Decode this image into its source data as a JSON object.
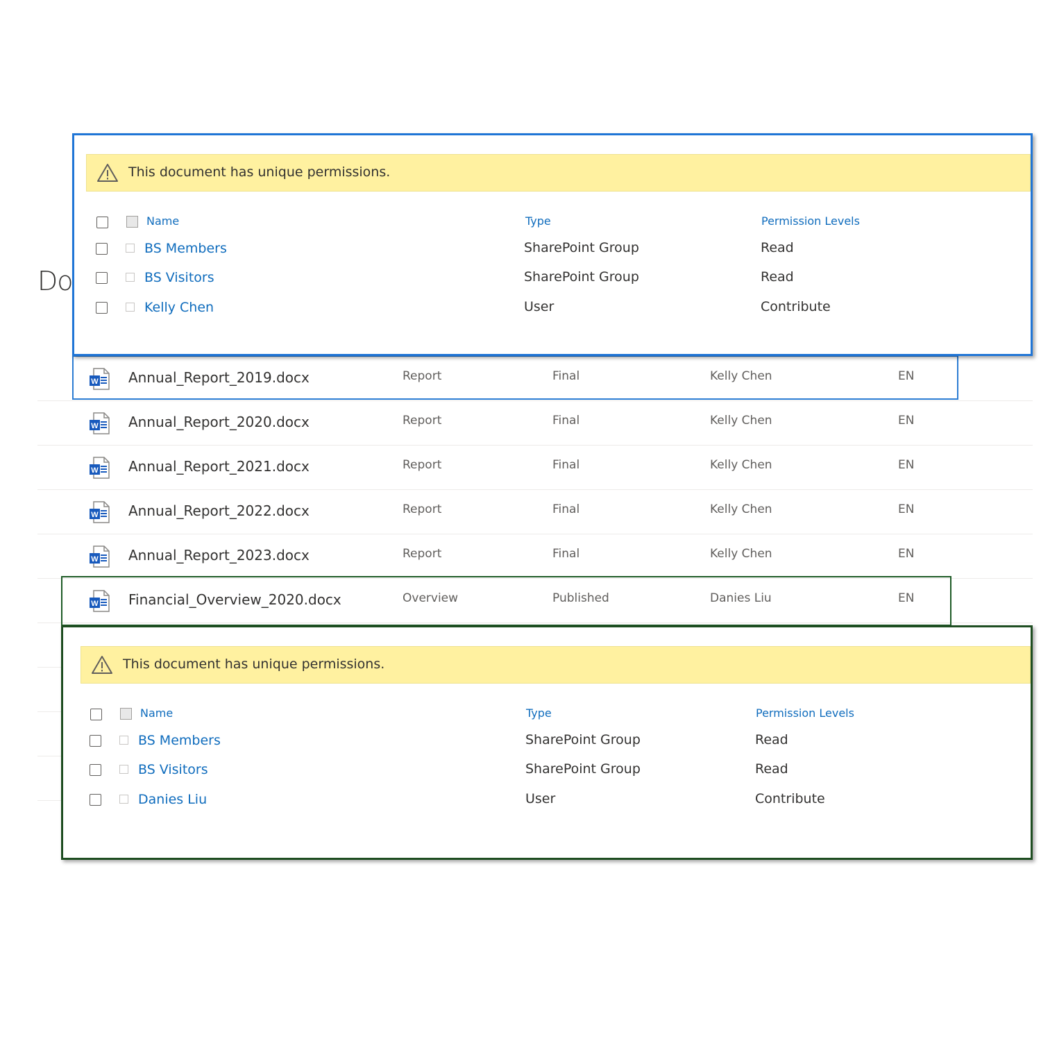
{
  "page": {
    "title_fragment": "Do"
  },
  "documents": [
    {
      "name": "Annual_Report_2019.docx",
      "type": "Report",
      "status": "Final",
      "owner": "Kelly Chen",
      "language": "EN"
    },
    {
      "name": "Annual_Report_2020.docx",
      "type": "Report",
      "status": "Final",
      "owner": "Kelly Chen",
      "language": "EN"
    },
    {
      "name": "Annual_Report_2021.docx",
      "type": "Report",
      "status": "Final",
      "owner": "Kelly Chen",
      "language": "EN"
    },
    {
      "name": "Annual_Report_2022.docx",
      "type": "Report",
      "status": "Final",
      "owner": "Kelly Chen",
      "language": "EN"
    },
    {
      "name": "Annual_Report_2023.docx",
      "type": "Report",
      "status": "Final",
      "owner": "Kelly Chen",
      "language": "EN"
    },
    {
      "name": "Financial_Overview_2020.docx",
      "type": "Overview",
      "status": "Published",
      "owner": "Danies Liu",
      "language": "EN"
    }
  ],
  "popup_blue": {
    "warning": "This document has unique permissions.",
    "headers": {
      "name": "Name",
      "type": "Type",
      "permission": "Permission Levels"
    },
    "rows": [
      {
        "name": "BS Members",
        "type": "SharePoint Group",
        "permission": "Read"
      },
      {
        "name": "BS Visitors",
        "type": "SharePoint Group",
        "permission": "Read"
      },
      {
        "name": "Kelly Chen",
        "type": "User",
        "permission": "Contribute"
      }
    ]
  },
  "popup_green": {
    "warning": "This document has unique permissions.",
    "headers": {
      "name": "Name",
      "type": "Type",
      "permission": "Permission Levels"
    },
    "rows": [
      {
        "name": "BS Members",
        "type": "SharePoint Group",
        "permission": "Read"
      },
      {
        "name": "BS Visitors",
        "type": "SharePoint Group",
        "permission": "Read"
      },
      {
        "name": "Danies Liu",
        "type": "User",
        "permission": "Contribute"
      }
    ]
  },
  "colors": {
    "highlight_blue": "#1f75d6",
    "highlight_green": "#1e4d21",
    "warning_bg": "#fff1a0",
    "link": "#0f6cbd",
    "word_icon": "#185abd"
  },
  "icons": {
    "file": "word-document-icon",
    "warning": "warning-triangle-icon"
  }
}
